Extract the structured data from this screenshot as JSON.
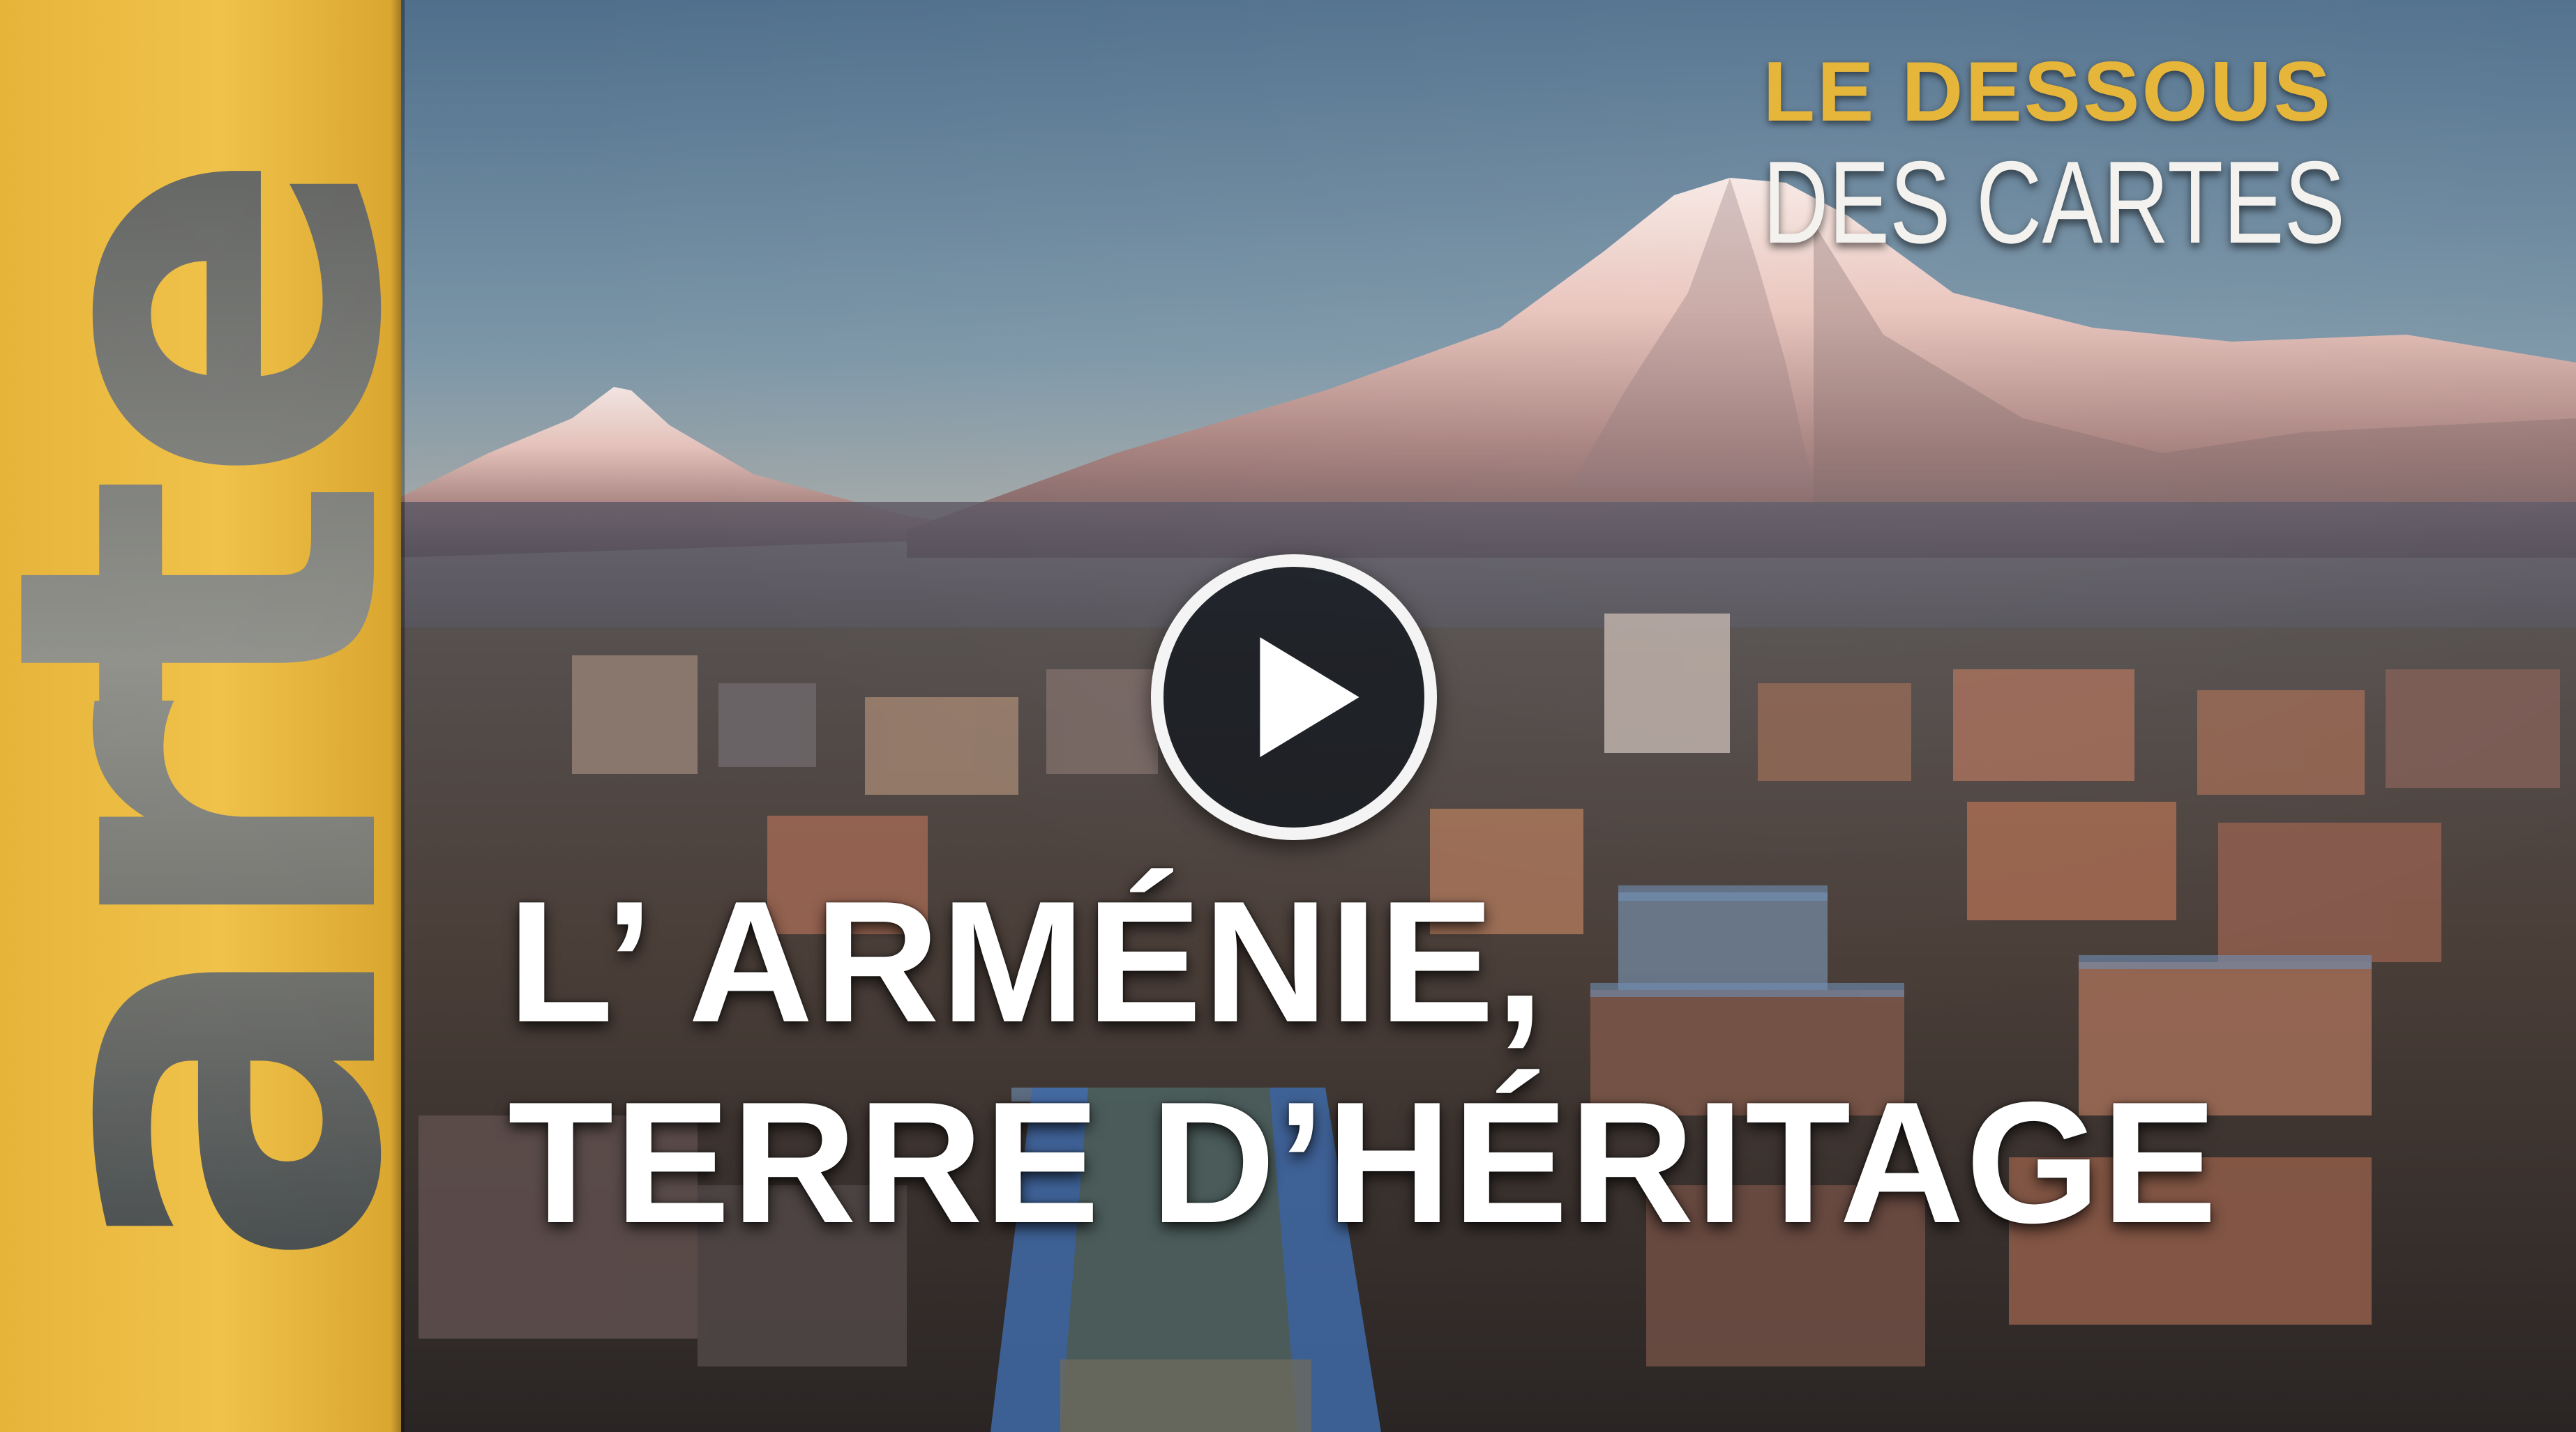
{
  "brand": {
    "channel_logo": "arte",
    "accent_color": "#f0c24a"
  },
  "show_logo": {
    "line1": "LE DESSOUS",
    "line2": "DES CARTES",
    "line1_color": "#e6b63b",
    "line2_color": "#f4f2ee"
  },
  "video": {
    "title_line1": "L’ ARMÉNIE,",
    "title_line2": "TERRE D’HÉRITAGE",
    "play_icon": "play-icon"
  }
}
